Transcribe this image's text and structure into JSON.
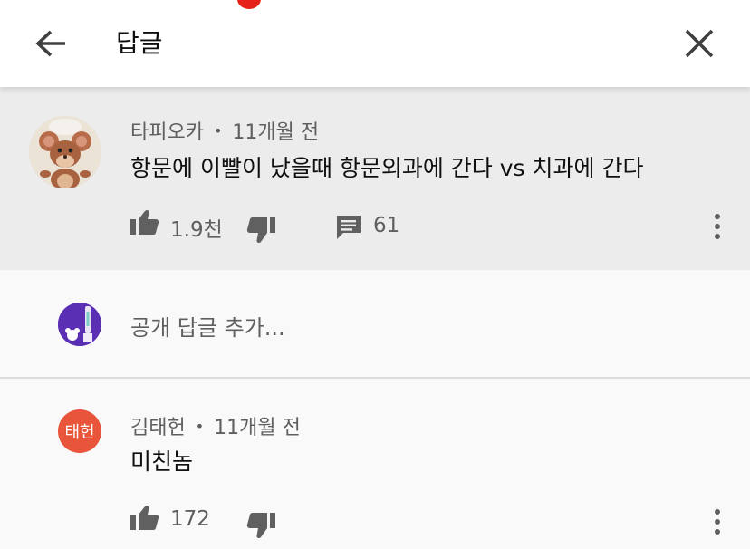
{
  "header": {
    "title": "답글"
  },
  "parent_comment": {
    "author": "타피오카",
    "time": "11개월 전",
    "text": "항문에 이빨이 났을때 항문외과에 간다 vs 치과에 간다",
    "likes": "1.9천",
    "replies": "61"
  },
  "reply_input": {
    "placeholder": "공개 답글 추가..."
  },
  "replies": [
    {
      "author": "김태헌",
      "avatar_text": "태헌",
      "time": "11개월 전",
      "text": "미친놈",
      "likes": "172"
    }
  ],
  "meta_separator": "•",
  "colors": {
    "header_bg": "#ffffff",
    "highlight_bg": "#ececec",
    "page_bg": "#f9f9f9",
    "initials_avatar": "#e8553a",
    "notification_dot": "#e62117"
  },
  "icons": [
    "back-arrow-icon",
    "close-icon",
    "thumbs-up-icon",
    "thumbs-down-icon",
    "comment-icon",
    "more-vert-icon"
  ]
}
